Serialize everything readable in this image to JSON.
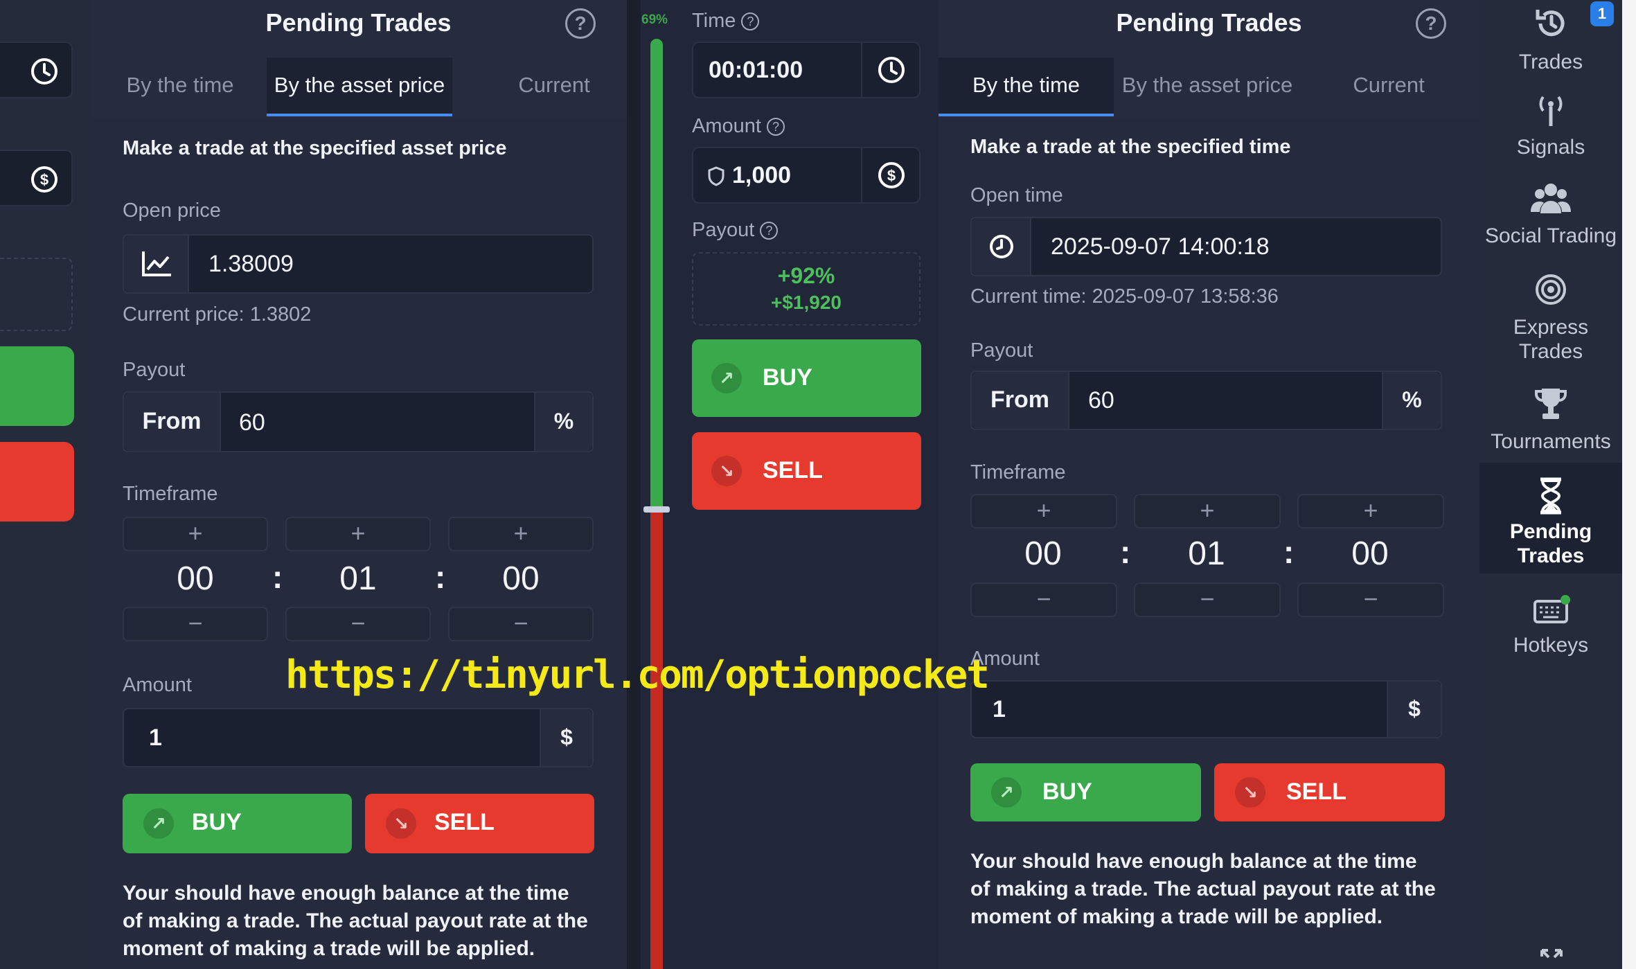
{
  "left_panel": {
    "title": "Pending Trades",
    "help_icon": "?",
    "tabs": [
      "By the time",
      "By the asset price",
      "Current"
    ],
    "active_tab": "By the asset price",
    "description": "Make a trade at the specified asset price",
    "open_price_label": "Open price",
    "open_price_value": "1.38009",
    "current_price": "Current price: 1.3802",
    "payout_label": "Payout",
    "payout_from": "From",
    "payout_value": "60",
    "payout_unit": "%",
    "timeframe_label": "Timeframe",
    "timeframe": {
      "hours": "00",
      "minutes": "01",
      "seconds": "00",
      "sep": ":"
    },
    "plus": "+",
    "minus": "−",
    "amount_label": "Amount",
    "amount_value": "1",
    "amount_unit": "$",
    "buy_label": "BUY",
    "sell_label": "SELL",
    "note": "Your should have enough balance at the time of making a trade. The actual payout rate at the moment of making a trade will be applied."
  },
  "middle": {
    "sentiment": "69%",
    "sentiment_fraction": 0.69,
    "time_label": "Time",
    "time_value": "00:01:00",
    "amount_label": "Amount",
    "amount_value": "1,000",
    "payout_label": "Payout",
    "payout_percent": "+92%",
    "payout_amount": "+$1,920",
    "buy_label": "BUY",
    "sell_label": "SELL",
    "help": "?"
  },
  "right_panel": {
    "title": "Pending Trades",
    "help_icon": "?",
    "tabs": [
      "By the time",
      "By the asset price",
      "Current"
    ],
    "active_tab": "By the time",
    "description": "Make a trade at the specified time",
    "open_time_label": "Open time",
    "open_time_value": "2025-09-07 14:00:18",
    "current_time": "Current time: 2025-09-07 13:58:36",
    "payout_label": "Payout",
    "payout_from": "From",
    "payout_value": "60",
    "payout_unit": "%",
    "timeframe_label": "Timeframe",
    "timeframe": {
      "hours": "00",
      "minutes": "01",
      "seconds": "00",
      "sep": ":"
    },
    "plus": "+",
    "minus": "−",
    "amount_label": "Amount",
    "amount_value": "1",
    "amount_unit": "$",
    "buy_label": "BUY",
    "sell_label": "SELL",
    "note": "Your should have enough balance at the time of making a trade. The actual payout rate at the moment of making a trade will be applied."
  },
  "nav": {
    "badge": "1",
    "items": [
      {
        "label": "Trades",
        "icon": "history-icon"
      },
      {
        "label": "Signals",
        "icon": "antenna-icon"
      },
      {
        "label": "Social Trading",
        "icon": "users-icon"
      },
      {
        "label": "Express Trades",
        "icon": "target-icon"
      },
      {
        "label": "Tournaments",
        "icon": "trophy-icon"
      },
      {
        "label": "Pending Trades",
        "icon": "hourglass-icon"
      },
      {
        "label": "Hotkeys",
        "icon": "keyboard-icon"
      }
    ]
  },
  "watermark": "https://tinyurl.com/optionpocket",
  "colors": {
    "green": "#3aa94b",
    "red": "#e63a2f",
    "accent": "#4a8bf0",
    "watermark": "#f6ea16"
  }
}
